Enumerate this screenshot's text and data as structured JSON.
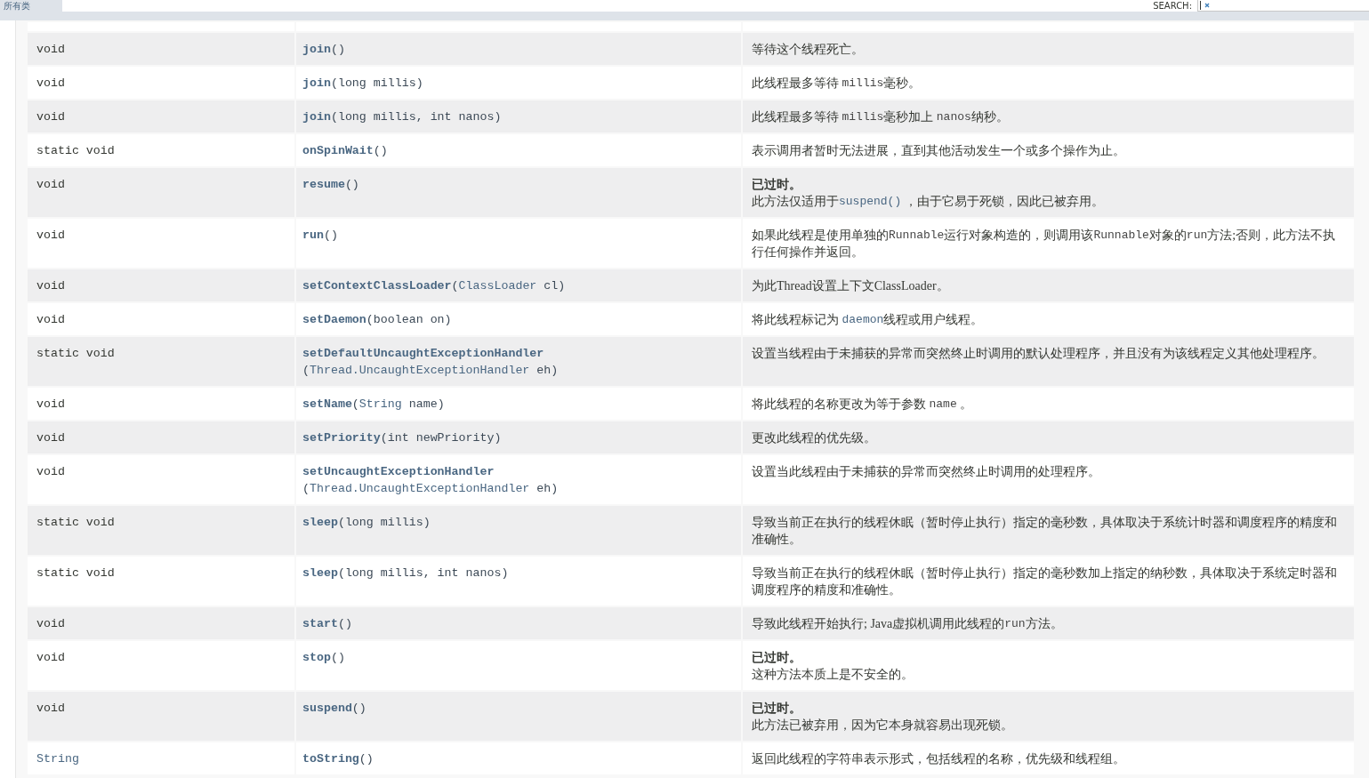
{
  "nav": {
    "all_classes": "所有类",
    "search": {
      "label": "SEARCH:",
      "focused": true
    }
  },
  "methods": [
    {
      "type": [
        {
          "kind": "code",
          "text": "void"
        }
      ],
      "name": "join",
      "params": [
        {
          "kind": "code",
          "text": "()"
        }
      ],
      "description": [
        {
          "kind": "text",
          "text": "等待这个线程死亡。"
        }
      ]
    },
    {
      "type": [
        {
          "kind": "code",
          "text": "void"
        }
      ],
      "name": "join",
      "params": [
        {
          "kind": "code",
          "text": "(long millis)"
        }
      ],
      "description": [
        {
          "kind": "text",
          "text": "此线程最多等待 "
        },
        {
          "kind": "code",
          "text": "millis"
        },
        {
          "kind": "text",
          "text": "毫秒。"
        }
      ]
    },
    {
      "type": [
        {
          "kind": "code",
          "text": "void"
        }
      ],
      "name": "join",
      "params": [
        {
          "kind": "code",
          "text": "(long millis, int nanos)"
        }
      ],
      "description": [
        {
          "kind": "text",
          "text": "此线程最多等待 "
        },
        {
          "kind": "code",
          "text": "millis"
        },
        {
          "kind": "text",
          "text": "毫秒加上 "
        },
        {
          "kind": "code",
          "text": "nanos"
        },
        {
          "kind": "text",
          "text": "纳秒。"
        }
      ]
    },
    {
      "type": [
        {
          "kind": "code",
          "text": "static void"
        }
      ],
      "name": "onSpinWait",
      "params": [
        {
          "kind": "code",
          "text": "()"
        }
      ],
      "description": [
        {
          "kind": "text",
          "text": "表示调用者暂时无法进展，直到其他活动发生一个或多个操作为止。"
        }
      ]
    },
    {
      "type": [
        {
          "kind": "code",
          "text": "void"
        }
      ],
      "name": "resume",
      "params": [
        {
          "kind": "code",
          "text": "()"
        }
      ],
      "deprecated_label": "已过时。",
      "description": [
        {
          "kind": "text",
          "text": "此方法仅适用于"
        },
        {
          "kind": "link",
          "text": "suspend()"
        },
        {
          "kind": "text",
          "text": " ，由于它易于死锁，因此已被弃用。"
        }
      ]
    },
    {
      "type": [
        {
          "kind": "code",
          "text": "void"
        }
      ],
      "name": "run",
      "params": [
        {
          "kind": "code",
          "text": "()"
        }
      ],
      "description": [
        {
          "kind": "text",
          "text": "如果此线程是使用单独的"
        },
        {
          "kind": "code",
          "text": "Runnable"
        },
        {
          "kind": "text",
          "text": "运行对象构造的，则调用该"
        },
        {
          "kind": "code",
          "text": "Runnable"
        },
        {
          "kind": "text",
          "text": "对象的"
        },
        {
          "kind": "code",
          "text": "run"
        },
        {
          "kind": "text",
          "text": "方法;否则，此方法不执行任何操作并返回。"
        }
      ]
    },
    {
      "type": [
        {
          "kind": "code",
          "text": "void"
        }
      ],
      "name": "setContextClassLoader",
      "params": [
        {
          "kind": "code",
          "text": "("
        },
        {
          "kind": "link",
          "text": "ClassLoader"
        },
        {
          "kind": "code",
          "text": " cl)"
        }
      ],
      "description": [
        {
          "kind": "text",
          "text": "为此Thread设置上下文ClassLoader。"
        }
      ]
    },
    {
      "type": [
        {
          "kind": "code",
          "text": "void"
        }
      ],
      "name": "setDaemon",
      "params": [
        {
          "kind": "code",
          "text": "(boolean on)"
        }
      ],
      "description": [
        {
          "kind": "text",
          "text": "将此线程标记为 "
        },
        {
          "kind": "link",
          "text": "daemon"
        },
        {
          "kind": "text",
          "text": "线程或用户线程。"
        }
      ]
    },
    {
      "type": [
        {
          "kind": "code",
          "text": "static void"
        }
      ],
      "name": "setDefaultUncaughtExceptionHandler",
      "params": [
        {
          "kind": "code",
          "text": "("
        },
        {
          "kind": "link",
          "text": "Thread.UncaughtExceptionHandler"
        },
        {
          "kind": "code",
          "text": " eh)"
        }
      ],
      "description": [
        {
          "kind": "text",
          "text": "设置当线程由于未捕获的异常而突然终止时调用的默认处理程序，并且没有为该线程定义其他处理程序。"
        }
      ]
    },
    {
      "type": [
        {
          "kind": "code",
          "text": "void"
        }
      ],
      "name": "setName",
      "params": [
        {
          "kind": "code",
          "text": "("
        },
        {
          "kind": "link",
          "text": "String"
        },
        {
          "kind": "code",
          "text": " name)"
        }
      ],
      "description": [
        {
          "kind": "text",
          "text": "将此线程的名称更改为等于参数 "
        },
        {
          "kind": "code",
          "text": "name"
        },
        {
          "kind": "text",
          "text": " 。"
        }
      ]
    },
    {
      "type": [
        {
          "kind": "code",
          "text": "void"
        }
      ],
      "name": "setPriority",
      "params": [
        {
          "kind": "code",
          "text": "(int newPriority)"
        }
      ],
      "description": [
        {
          "kind": "text",
          "text": "更改此线程的优先级。"
        }
      ]
    },
    {
      "type": [
        {
          "kind": "code",
          "text": "void"
        }
      ],
      "name": "setUncaughtExceptionHandler",
      "params": [
        {
          "kind": "code",
          "text": "("
        },
        {
          "kind": "link",
          "text": "Thread.UncaughtExceptionHandler"
        },
        {
          "kind": "code",
          "text": " eh)"
        }
      ],
      "description": [
        {
          "kind": "text",
          "text": "设置当此线程由于未捕获的异常而突然终止时调用的处理程序。"
        }
      ]
    },
    {
      "type": [
        {
          "kind": "code",
          "text": "static void"
        }
      ],
      "name": "sleep",
      "params": [
        {
          "kind": "code",
          "text": "(long millis)"
        }
      ],
      "description": [
        {
          "kind": "text",
          "text": "导致当前正在执行的线程休眠（暂时停止执行）指定的毫秒数，具体取决于系统计时器和调度程序的精度和准确性。"
        }
      ]
    },
    {
      "type": [
        {
          "kind": "code",
          "text": "static void"
        }
      ],
      "name": "sleep",
      "params": [
        {
          "kind": "code",
          "text": "(long millis, int nanos)"
        }
      ],
      "description": [
        {
          "kind": "text",
          "text": "导致当前正在执行的线程休眠（暂时停止执行）指定的毫秒数加上指定的纳秒数，具体取决于系统定时器和调度程序的精度和准确性。"
        }
      ]
    },
    {
      "type": [
        {
          "kind": "code",
          "text": "void"
        }
      ],
      "name": "start",
      "params": [
        {
          "kind": "code",
          "text": "()"
        }
      ],
      "description": [
        {
          "kind": "text",
          "text": "导致此线程开始执行; Java虚拟机调用此线程的"
        },
        {
          "kind": "code",
          "text": "run"
        },
        {
          "kind": "text",
          "text": "方法。"
        }
      ]
    },
    {
      "type": [
        {
          "kind": "code",
          "text": "void"
        }
      ],
      "name": "stop",
      "params": [
        {
          "kind": "code",
          "text": "()"
        }
      ],
      "deprecated_label": "已过时。",
      "description": [
        {
          "kind": "text",
          "text": "这种方法本质上是不安全的。"
        }
      ]
    },
    {
      "type": [
        {
          "kind": "code",
          "text": "void"
        }
      ],
      "name": "suspend",
      "params": [
        {
          "kind": "code",
          "text": "()"
        }
      ],
      "deprecated_label": "已过时。",
      "description": [
        {
          "kind": "text",
          "text": "此方法已被弃用，因为它本身就容易出现死锁。"
        }
      ]
    },
    {
      "type": [
        {
          "kind": "link",
          "text": "String"
        }
      ],
      "name": "toString",
      "params": [
        {
          "kind": "code",
          "text": "()"
        }
      ],
      "description": [
        {
          "kind": "text",
          "text": "返回此线程的字符串表示形式，包括线程的名称，优先级和线程组。"
        }
      ]
    }
  ]
}
